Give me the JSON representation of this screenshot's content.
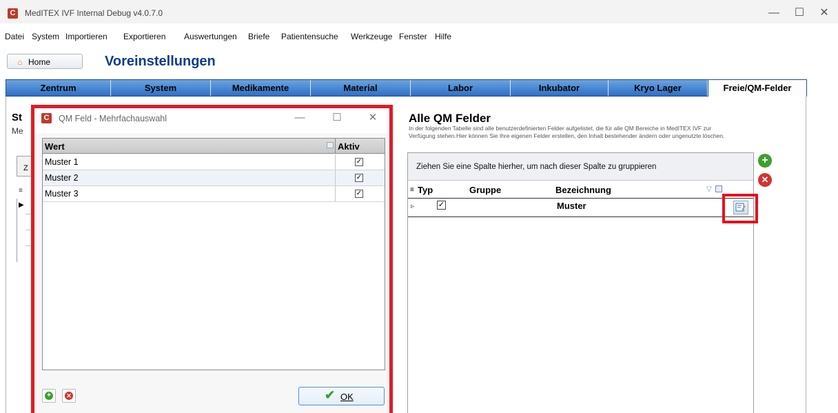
{
  "app": {
    "title": "MedITEX IVF Internal Debug v4.0.7.0",
    "logo_letter": "C",
    "window_controls": {
      "minimize": "—",
      "maximize": "☐",
      "close": "✕"
    }
  },
  "menu": [
    "Datei",
    "System",
    "Importieren",
    "Exportieren",
    "Auswertungen",
    "Briefe",
    "Patientensuche",
    "Werkzeuge",
    "Fenster",
    "Hilfe"
  ],
  "header": {
    "home_label": "Home",
    "page_title": "Voreinstellungen"
  },
  "tabs": [
    {
      "label": "Zentrum",
      "active": false
    },
    {
      "label": "System",
      "active": false
    },
    {
      "label": "Medikamente",
      "active": false
    },
    {
      "label": "Material",
      "active": false
    },
    {
      "label": "Labor",
      "active": false
    },
    {
      "label": "Inkubator",
      "active": false
    },
    {
      "label": "Kryo Lager",
      "active": false
    },
    {
      "label": "Freie/QM-Felder",
      "active": true
    }
  ],
  "left_panel": {
    "title_fragment": "St",
    "subtitle_fragment": "Me",
    "col_fragment": "Z"
  },
  "qm_panel": {
    "title": "Alle QM Felder",
    "description": "In der folgenden Tabelle sind alle benutzerdefinierten Felder aufgelistet, die für alle QM Bereiche in MedITEX IVF zur Verfügung stehen.Hier können Sie Ihre eigenen Felder erstellen, den Inhalt bestehender ändern oder ungenutzte löschen.",
    "group_hint": "Ziehen Sie eine Spalte hierher, um nach dieser Spalte zu gruppieren",
    "columns": [
      "Typ",
      "Gruppe",
      "Bezeichnung"
    ],
    "rows": [
      {
        "typ_checked": true,
        "gruppe": "",
        "bezeichnung": "Muster"
      }
    ]
  },
  "dialog": {
    "title": "QM Feld - Mehrfachauswahl",
    "columns": {
      "wert": "Wert",
      "aktiv": "Aktiv"
    },
    "rows": [
      {
        "wert": "Muster 1",
        "aktiv": true
      },
      {
        "wert": "Muster 2",
        "aktiv": true
      },
      {
        "wert": "Muster 3",
        "aktiv": true
      }
    ],
    "ok_label": "OK"
  },
  "colors": {
    "highlight": "#e11b25",
    "title_blue": "#0f3c8d",
    "tab_blue": "#2f6fc4"
  }
}
